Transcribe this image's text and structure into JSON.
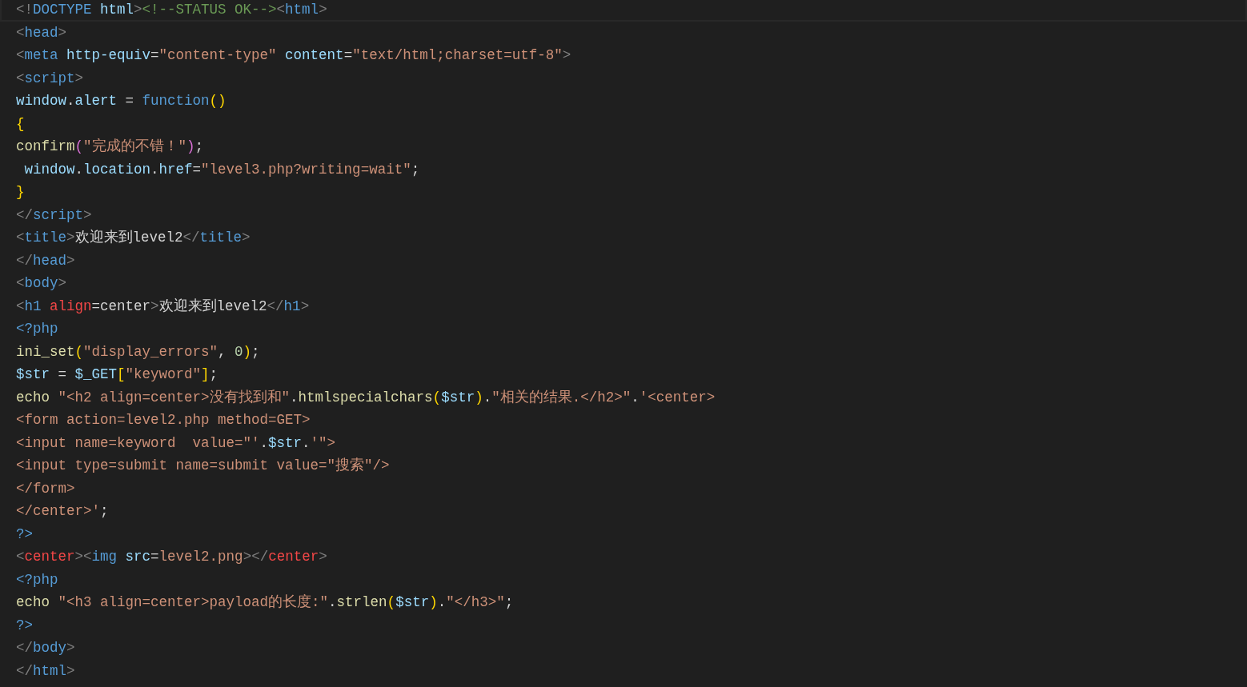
{
  "editor": {
    "lines": [
      {
        "current": true,
        "tokens": [
          {
            "kind": "punct",
            "text": "<!"
          },
          {
            "kind": "tag",
            "text": "DOCTYPE"
          },
          {
            "kind": "attr",
            "text": " html"
          },
          {
            "kind": "punct",
            "text": ">"
          },
          {
            "kind": "comment",
            "text": "<!--STATUS OK-->"
          },
          {
            "kind": "punct",
            "text": "<"
          },
          {
            "kind": "tag",
            "text": "html"
          },
          {
            "kind": "punct",
            "text": ">"
          }
        ]
      },
      {
        "current": false,
        "tokens": [
          {
            "kind": "punct",
            "text": "<"
          },
          {
            "kind": "tag",
            "text": "head"
          },
          {
            "kind": "punct",
            "text": ">"
          }
        ]
      },
      {
        "current": false,
        "tokens": [
          {
            "kind": "punct",
            "text": "<"
          },
          {
            "kind": "tag",
            "text": "meta"
          },
          {
            "kind": "attr",
            "text": " http-equiv"
          },
          {
            "kind": "plain",
            "text": "="
          },
          {
            "kind": "string",
            "text": "\"content-type\""
          },
          {
            "kind": "attr",
            "text": " content"
          },
          {
            "kind": "plain",
            "text": "="
          },
          {
            "kind": "string",
            "text": "\"text/html;charset=utf-8\""
          },
          {
            "kind": "punct",
            "text": ">"
          }
        ]
      },
      {
        "current": false,
        "tokens": [
          {
            "kind": "punct",
            "text": "<"
          },
          {
            "kind": "tag",
            "text": "script"
          },
          {
            "kind": "punct",
            "text": ">"
          }
        ]
      },
      {
        "current": false,
        "tokens": [
          {
            "kind": "var",
            "text": "window"
          },
          {
            "kind": "plain",
            "text": "."
          },
          {
            "kind": "var",
            "text": "alert"
          },
          {
            "kind": "plain",
            "text": " = "
          },
          {
            "kind": "keyword",
            "text": "function"
          },
          {
            "kind": "brace",
            "text": "()"
          }
        ]
      },
      {
        "current": false,
        "tokens": [
          {
            "kind": "brace",
            "text": "{"
          }
        ]
      },
      {
        "current": false,
        "tokens": [
          {
            "kind": "func",
            "text": "confirm"
          },
          {
            "kind": "paren",
            "text": "("
          },
          {
            "kind": "string",
            "text": "\"完成的不错！\""
          },
          {
            "kind": "paren",
            "text": ")"
          },
          {
            "kind": "plain",
            "text": ";"
          }
        ]
      },
      {
        "current": false,
        "tokens": [
          {
            "kind": "var",
            "text": " window"
          },
          {
            "kind": "plain",
            "text": "."
          },
          {
            "kind": "var",
            "text": "location"
          },
          {
            "kind": "plain",
            "text": "."
          },
          {
            "kind": "var",
            "text": "href"
          },
          {
            "kind": "plain",
            "text": "="
          },
          {
            "kind": "string",
            "text": "\"level3.php?writing=wait\""
          },
          {
            "kind": "plain",
            "text": ";"
          }
        ]
      },
      {
        "current": false,
        "tokens": [
          {
            "kind": "brace",
            "text": "}"
          }
        ]
      },
      {
        "current": false,
        "tokens": [
          {
            "kind": "punct",
            "text": "</"
          },
          {
            "kind": "tag",
            "text": "script"
          },
          {
            "kind": "punct",
            "text": ">"
          }
        ]
      },
      {
        "current": false,
        "tokens": [
          {
            "kind": "punct",
            "text": "<"
          },
          {
            "kind": "tag",
            "text": "title"
          },
          {
            "kind": "punct",
            "text": ">"
          },
          {
            "kind": "plain",
            "text": "欢迎来到level2"
          },
          {
            "kind": "punct",
            "text": "</"
          },
          {
            "kind": "tag",
            "text": "title"
          },
          {
            "kind": "punct",
            "text": ">"
          }
        ]
      },
      {
        "current": false,
        "tokens": [
          {
            "kind": "punct",
            "text": "</"
          },
          {
            "kind": "tag",
            "text": "head"
          },
          {
            "kind": "punct",
            "text": ">"
          }
        ]
      },
      {
        "current": false,
        "tokens": [
          {
            "kind": "punct",
            "text": "<"
          },
          {
            "kind": "tag",
            "text": "body"
          },
          {
            "kind": "punct",
            "text": ">"
          }
        ]
      },
      {
        "current": false,
        "tokens": [
          {
            "kind": "punct",
            "text": "<"
          },
          {
            "kind": "tag",
            "text": "h1"
          },
          {
            "kind": "invalid",
            "text": " align"
          },
          {
            "kind": "plain",
            "text": "=center"
          },
          {
            "kind": "punct",
            "text": ">"
          },
          {
            "kind": "plain",
            "text": "欢迎来到level2"
          },
          {
            "kind": "punct",
            "text": "</"
          },
          {
            "kind": "tag",
            "text": "h1"
          },
          {
            "kind": "punct",
            "text": ">"
          }
        ]
      },
      {
        "current": false,
        "tokens": [
          {
            "kind": "tag",
            "text": "<?php"
          }
        ]
      },
      {
        "current": false,
        "tokens": [
          {
            "kind": "func",
            "text": "ini_set"
          },
          {
            "kind": "brace",
            "text": "("
          },
          {
            "kind": "string",
            "text": "\"display_errors\""
          },
          {
            "kind": "plain",
            "text": ", "
          },
          {
            "kind": "number",
            "text": "0"
          },
          {
            "kind": "brace",
            "text": ")"
          },
          {
            "kind": "plain",
            "text": ";"
          }
        ]
      },
      {
        "current": false,
        "tokens": [
          {
            "kind": "var",
            "text": "$str"
          },
          {
            "kind": "plain",
            "text": " = "
          },
          {
            "kind": "var",
            "text": "$_GET"
          },
          {
            "kind": "brace",
            "text": "["
          },
          {
            "kind": "string",
            "text": "\"keyword\""
          },
          {
            "kind": "brace",
            "text": "]"
          },
          {
            "kind": "plain",
            "text": ";"
          }
        ]
      },
      {
        "current": false,
        "tokens": [
          {
            "kind": "func",
            "text": "echo"
          },
          {
            "kind": "string",
            "text": " \"<h2 align=center>没有找到和\""
          },
          {
            "kind": "plain",
            "text": "."
          },
          {
            "kind": "func",
            "text": "htmlspecialchars"
          },
          {
            "kind": "brace",
            "text": "("
          },
          {
            "kind": "var",
            "text": "$str"
          },
          {
            "kind": "brace",
            "text": ")"
          },
          {
            "kind": "plain",
            "text": "."
          },
          {
            "kind": "string",
            "text": "\"相关的结果.</h2>\""
          },
          {
            "kind": "plain",
            "text": "."
          },
          {
            "kind": "string",
            "text": "'<center>"
          }
        ]
      },
      {
        "current": false,
        "tokens": [
          {
            "kind": "string",
            "text": "<form action=level2.php method=GET>"
          }
        ]
      },
      {
        "current": false,
        "tokens": [
          {
            "kind": "string",
            "text": "<input name=keyword  value=\"'"
          },
          {
            "kind": "plain",
            "text": "."
          },
          {
            "kind": "var",
            "text": "$str"
          },
          {
            "kind": "plain",
            "text": "."
          },
          {
            "kind": "string",
            "text": "'\">"
          }
        ]
      },
      {
        "current": false,
        "tokens": [
          {
            "kind": "string",
            "text": "<input type=submit name=submit value=\"搜索\"/>"
          }
        ]
      },
      {
        "current": false,
        "tokens": [
          {
            "kind": "string",
            "text": "</form>"
          }
        ]
      },
      {
        "current": false,
        "tokens": [
          {
            "kind": "string",
            "text": "</center>'"
          },
          {
            "kind": "plain",
            "text": ";"
          }
        ]
      },
      {
        "current": false,
        "tokens": [
          {
            "kind": "tag",
            "text": "?>"
          }
        ]
      },
      {
        "current": false,
        "tokens": [
          {
            "kind": "punct",
            "text": "<"
          },
          {
            "kind": "invalid",
            "text": "center"
          },
          {
            "kind": "punct",
            "text": ">"
          },
          {
            "kind": "punct",
            "text": "<"
          },
          {
            "kind": "tag",
            "text": "img"
          },
          {
            "kind": "attr",
            "text": " src"
          },
          {
            "kind": "plain",
            "text": "="
          },
          {
            "kind": "string",
            "text": "level2.png"
          },
          {
            "kind": "punct",
            "text": ">"
          },
          {
            "kind": "punct",
            "text": "</"
          },
          {
            "kind": "invalid",
            "text": "center"
          },
          {
            "kind": "punct",
            "text": ">"
          }
        ]
      },
      {
        "current": false,
        "tokens": [
          {
            "kind": "tag",
            "text": "<?php"
          }
        ]
      },
      {
        "current": false,
        "tokens": [
          {
            "kind": "func",
            "text": "echo"
          },
          {
            "kind": "string",
            "text": " \"<h3 align=center>payload的长度:\""
          },
          {
            "kind": "plain",
            "text": "."
          },
          {
            "kind": "func",
            "text": "strlen"
          },
          {
            "kind": "brace",
            "text": "("
          },
          {
            "kind": "var",
            "text": "$str"
          },
          {
            "kind": "brace",
            "text": ")"
          },
          {
            "kind": "plain",
            "text": "."
          },
          {
            "kind": "string",
            "text": "\"</h3>\""
          },
          {
            "kind": "plain",
            "text": ";"
          }
        ]
      },
      {
        "current": false,
        "tokens": [
          {
            "kind": "tag",
            "text": "?>"
          }
        ]
      },
      {
        "current": false,
        "tokens": [
          {
            "kind": "punct",
            "text": "</"
          },
          {
            "kind": "tag",
            "text": "body"
          },
          {
            "kind": "punct",
            "text": ">"
          }
        ]
      },
      {
        "current": false,
        "tokens": [
          {
            "kind": "punct",
            "text": "</"
          },
          {
            "kind": "tag",
            "text": "html"
          },
          {
            "kind": "punct",
            "text": ">"
          }
        ]
      }
    ]
  }
}
